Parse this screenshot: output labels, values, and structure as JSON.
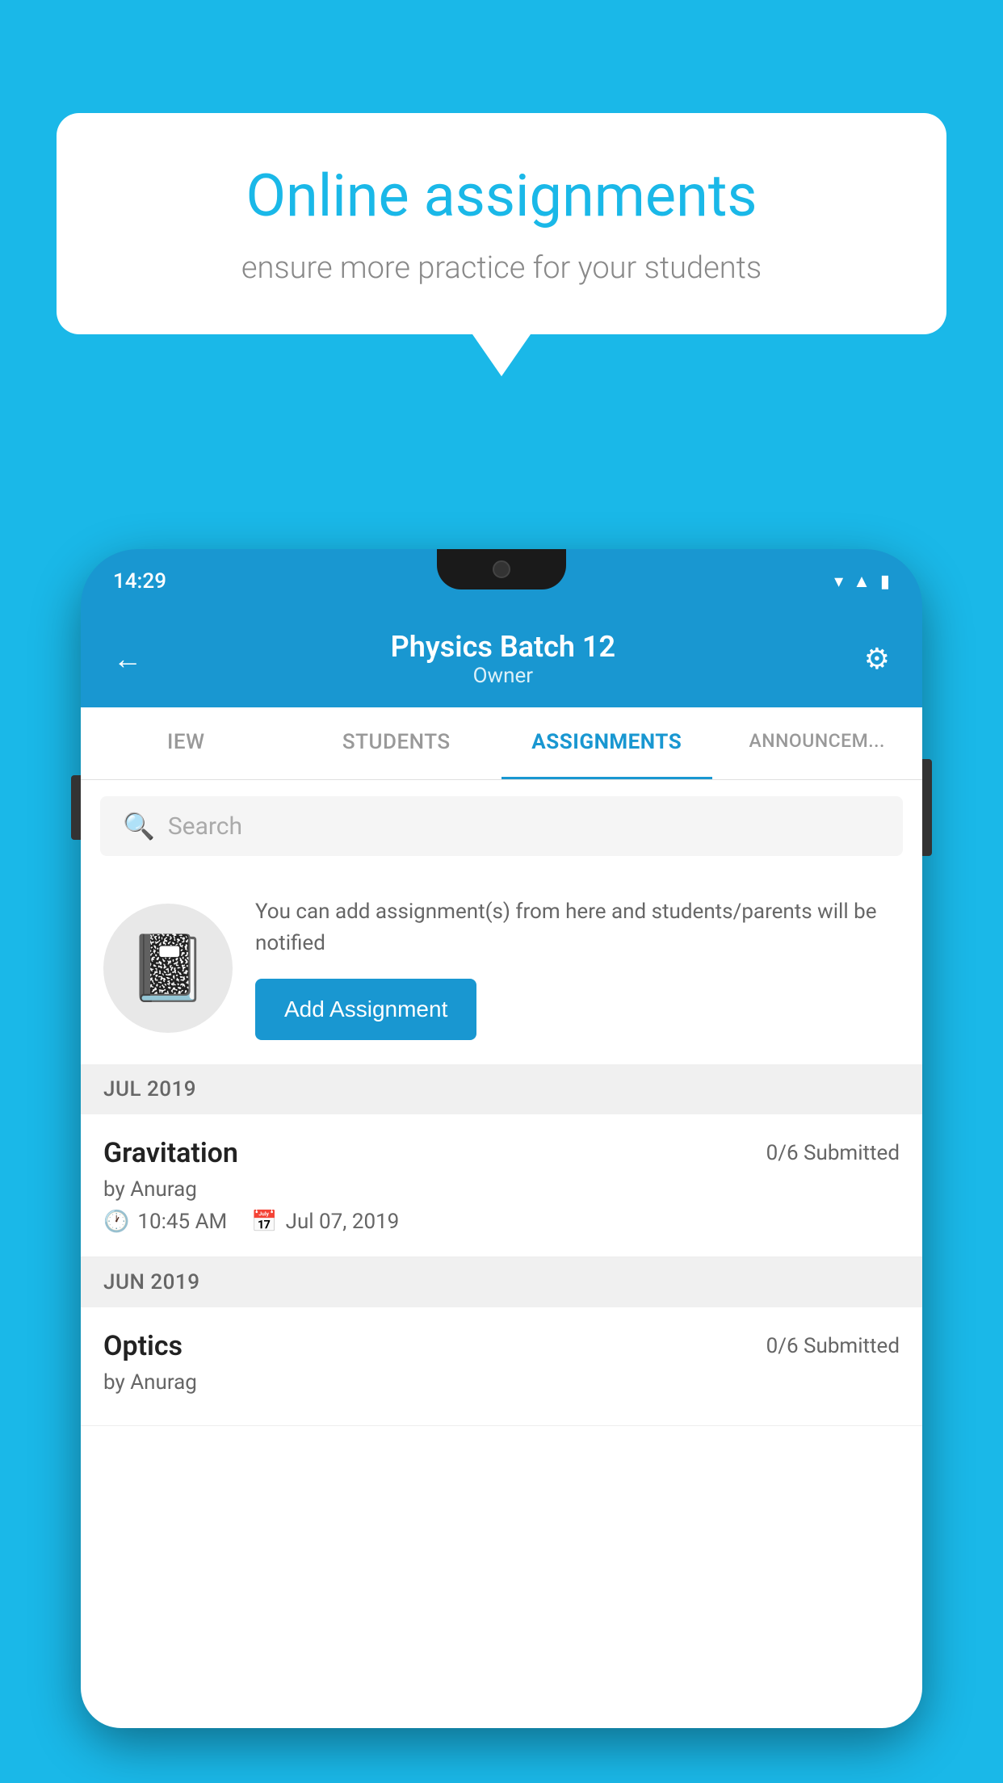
{
  "background_color": "#1ab8e8",
  "speech_bubble": {
    "title": "Online assignments",
    "subtitle": "ensure more practice for your students"
  },
  "phone": {
    "status_time": "14:29",
    "header": {
      "title": "Physics Batch 12",
      "subtitle": "Owner",
      "back_label": "←",
      "settings_label": "⚙"
    },
    "tabs": [
      {
        "label": "IEW",
        "active": false
      },
      {
        "label": "STUDENTS",
        "active": false
      },
      {
        "label": "ASSIGNMENTS",
        "active": true
      },
      {
        "label": "ANNOUNCEM...",
        "active": false
      }
    ],
    "search": {
      "placeholder": "Search"
    },
    "info_card": {
      "description": "You can add assignment(s) from here and students/parents will be notified",
      "add_button_label": "Add Assignment"
    },
    "sections": [
      {
        "month_label": "JUL 2019",
        "assignments": [
          {
            "name": "Gravitation",
            "submitted": "0/6 Submitted",
            "by": "by Anurag",
            "time": "10:45 AM",
            "date": "Jul 07, 2019"
          }
        ]
      },
      {
        "month_label": "JUN 2019",
        "assignments": [
          {
            "name": "Optics",
            "submitted": "0/6 Submitted",
            "by": "by Anurag",
            "time": "",
            "date": ""
          }
        ]
      }
    ]
  }
}
